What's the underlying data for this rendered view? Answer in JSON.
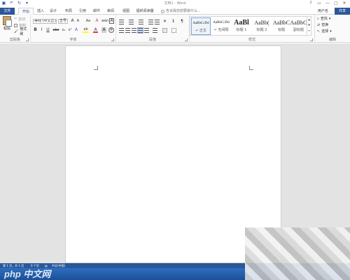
{
  "window": {
    "title": "文档1 - Word",
    "controls": [
      "?",
      "▭",
      "—",
      "▢",
      "✕"
    ]
  },
  "quick_access": [
    "save",
    "undo",
    "redo",
    "customize"
  ],
  "tabs": [
    "文件",
    "开始",
    "插入",
    "设计",
    "布局",
    "引用",
    "邮件",
    "审阅",
    "视图",
    "福昕阅读器"
  ],
  "tell_me": "告诉我您想要做什么...",
  "user": "用户名",
  "share": "共享",
  "ribbon": {
    "clipboard": {
      "label": "剪贴板",
      "paste": "粘贴",
      "cut": "剪切",
      "copy": "复制",
      "format_painter": "格式刷"
    },
    "font": {
      "label": "字体",
      "font_name": "等线 (中文正文)",
      "font_size": "五号",
      "grow": "A",
      "shrink": "A",
      "case": "Aa",
      "clear": "A",
      "wen": "wén",
      "border_a": "A",
      "bold": "B",
      "italic": "I",
      "underline": "U",
      "strike": "abc",
      "sub": "x₂",
      "sup": "x²",
      "highlight": "ab",
      "font_color": "A",
      "char_shade": "A",
      "enclose": "字"
    },
    "paragraph": {
      "label": "段落"
    },
    "styles": {
      "label": "样式",
      "items": [
        {
          "sample": "AaBbCcDd",
          "name": "↵ 正文"
        },
        {
          "sample": "AaBbCcDd",
          "name": "↵ 无间隔"
        },
        {
          "sample": "AaBl",
          "name": "标题 1"
        },
        {
          "sample": "AaBb(",
          "name": "标题 2"
        },
        {
          "sample": "AaBbC",
          "name": "标题"
        },
        {
          "sample": "AaBbC",
          "name": "副标题"
        }
      ]
    },
    "editing": {
      "label": "编辑",
      "find": "查找",
      "replace": "替换",
      "select": "选择"
    }
  },
  "status": {
    "page": "第 1 页，共 1 页",
    "words": "0 个字",
    "language": "中文(中国)"
  },
  "watermark": "php 中文网"
}
